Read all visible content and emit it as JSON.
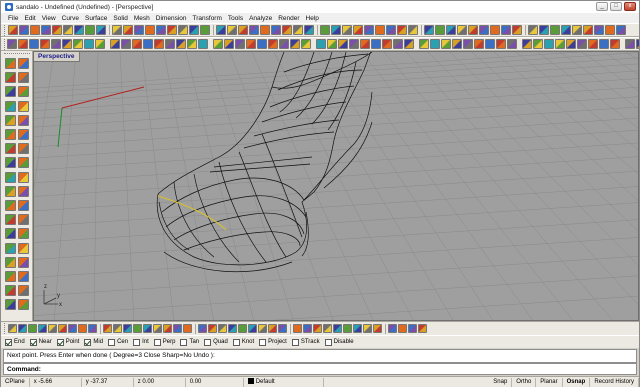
{
  "window": {
    "title": "sandalo - Undefined (Undefined) - [Perspective]",
    "controls": {
      "minimize": "_",
      "maximize": "□",
      "close": "x"
    }
  },
  "menu": [
    "File",
    "Edit",
    "View",
    "Curve",
    "Surface",
    "Solid",
    "Mesh",
    "Dimension",
    "Transform",
    "Tools",
    "Analyze",
    "Render",
    "Help"
  ],
  "viewport": {
    "label": "Perspective",
    "axis_labels": {
      "y": "y",
      "z": "z",
      "x": "x"
    }
  },
  "osnap": {
    "items": [
      {
        "label": "End",
        "checked": true
      },
      {
        "label": "Near",
        "checked": true
      },
      {
        "label": "Point",
        "checked": true
      },
      {
        "label": "Mid",
        "checked": true
      },
      {
        "label": "Cen",
        "checked": false
      },
      {
        "label": "Int",
        "checked": false
      },
      {
        "label": "Perp",
        "checked": false
      },
      {
        "label": "Tan",
        "checked": false
      },
      {
        "label": "Quad",
        "checked": false
      },
      {
        "label": "Knot",
        "checked": false
      },
      {
        "label": "Project",
        "checked": false
      },
      {
        "label": "STrack",
        "checked": false
      },
      {
        "label": "Disable",
        "checked": false
      }
    ]
  },
  "command": {
    "history": "Next point. Press Enter when done ( Degree=3  Close  Sharp=No  Undo ):",
    "prompt_label": "Command:",
    "input_value": ""
  },
  "status": {
    "cplane": "CPlane",
    "x": "x -5.66",
    "y": "y -37.37",
    "z": "z 0.00",
    "value": "0.00",
    "layer": "Default",
    "buttons": [
      {
        "label": "Snap",
        "active": false
      },
      {
        "label": "Ortho",
        "active": false
      },
      {
        "label": "Planar",
        "active": false
      },
      {
        "label": "Osnap",
        "active": true
      },
      {
        "label": "Record History",
        "active": false
      }
    ]
  },
  "icon_palette": [
    "#3a6fc4",
    "#d9a024",
    "#5a9b3a",
    "#c23b2f",
    "#7a4fa8",
    "#2aa0b0",
    "#6f6f6f",
    "#e06a1e",
    "#e8c73a",
    "#3c3c9c"
  ]
}
